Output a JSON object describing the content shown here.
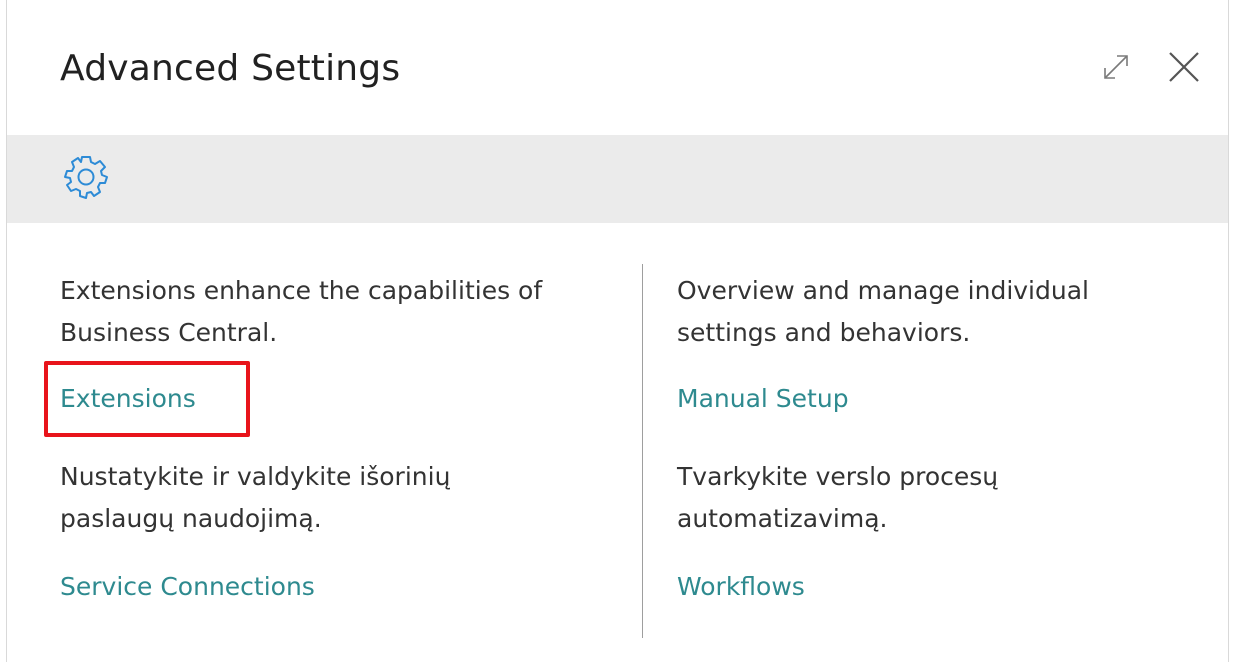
{
  "dialog": {
    "title": "Advanced Settings",
    "actions": {
      "expand_icon": "expand-icon",
      "close_icon": "close-icon"
    },
    "banner": {
      "icon": "gear-icon",
      "icon_color": "#2d8bd6"
    }
  },
  "colors": {
    "link": "#2e8a8f",
    "text": "#333333",
    "banner_bg": "#ebebeb",
    "highlight": "#e8141b"
  },
  "left_column": {
    "items": [
      {
        "description": "Extensions enhance the capabilities of\nBusiness Central.",
        "link": "Extensions",
        "highlighted": true
      },
      {
        "description": "Nustatykite ir valdykite išorinių\npaslaugų naudojimą.",
        "link": "Service Connections"
      }
    ]
  },
  "right_column": {
    "items": [
      {
        "description": "Overview and manage individual\nsettings and behaviors.",
        "link": "Manual Setup"
      },
      {
        "description": "Tvarkykite verslo procesų\nautomatizavimą.",
        "link": "Workflows"
      }
    ]
  }
}
